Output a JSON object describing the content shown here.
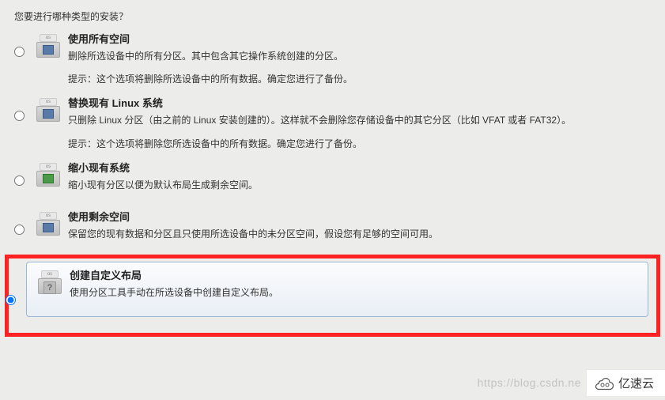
{
  "question": "您要进行哪种类型的安装？",
  "options": [
    {
      "key": "use_all",
      "title": "使用所有空间",
      "desc": "删除所选设备中的所有分区。其中包含其它操作系统创建的分区。",
      "hint": "提示：这个选项将删除所选设备中的所有数据。确定您进行了备份。",
      "icon": "disk-blue"
    },
    {
      "key": "replace_linux",
      "title": "替换现有 Linux 系统",
      "desc": "只删除 Linux 分区（由之前的 Linux 安装创建的）。这样就不会删除您存储设备中的其它分区（比如 VFAT 或者 FAT32）。",
      "hint": "提示：这个选项将删除您所选设备中的所有数据。确定您进行了备份。",
      "icon": "disk-blue"
    },
    {
      "key": "shrink",
      "title": "缩小现有系统",
      "desc": "缩小现有分区以便为默认布局生成剩余空间。",
      "hint": "",
      "icon": "disk-green"
    },
    {
      "key": "use_free",
      "title": "使用剩余空间",
      "desc": "保留您的现有数据和分区且只使用所选设备中的未分区空间，假设您有足够的空间可用。",
      "hint": "",
      "icon": "disk-blue"
    },
    {
      "key": "custom",
      "title": "创建自定义布局",
      "desc": "使用分区工具手动在所选设备中创建自定义布局。",
      "hint": "",
      "icon": "disk-q",
      "selected": true
    }
  ],
  "watermark": "https://blog.csdn.ne",
  "brand": "亿速云"
}
